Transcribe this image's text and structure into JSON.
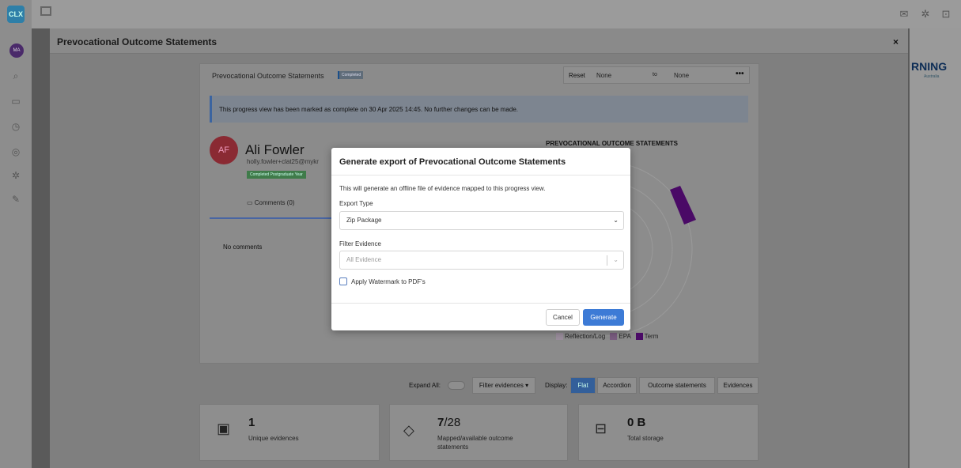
{
  "app": {
    "logo_text": "CLX",
    "user_initials": "MA",
    "brand_text": "RNING",
    "brand_sub": "Australia"
  },
  "outer_modal": {
    "title": "Prevocational Outcome Statements",
    "close_label": "×"
  },
  "progress_card": {
    "title": "Prevocational Outcome Statements",
    "status_badge": "Completed",
    "reset_label": "Reset",
    "from_value": "None",
    "to_label": "to",
    "to_value": "None",
    "more_label": "•••",
    "notice": "This progress view has been marked as complete on 30 Apr 2025 14:45. No further changes can be made.",
    "person": {
      "initials": "AF",
      "name": "Ali Fowler",
      "email": "holly.fowler+clat25@mykr",
      "badge": "Completed Postgraduate Year"
    },
    "comments_tab": "Comments (0)",
    "no_comments": "No comments",
    "chart_title": "PREVOCATIONAL OUTCOME STATEMENTS",
    "legend": [
      {
        "label": "Reflection/Log",
        "color": "#c9a8cf"
      },
      {
        "label": "EPA",
        "color": "#a45db0"
      },
      {
        "label": "Term",
        "color": "#6a0a92"
      }
    ]
  },
  "toolbar": {
    "expand_all": "Expand All:",
    "filter_evidences": "Filter evidences ▾",
    "display_label": "Display:",
    "display_options": [
      "Flat",
      "Accordion",
      "Outcome statements",
      "Evidences"
    ],
    "active_display": "Flat"
  },
  "stats": [
    {
      "value": "1",
      "label": "Unique evidences",
      "icon": "image-document-icon"
    },
    {
      "value": "7",
      "value_suffix": "/28",
      "label": "Mapped/available outcome statements",
      "icon": "tag-icon"
    },
    {
      "value": "0 B",
      "label": "Total storage",
      "icon": "hard-drive-icon"
    }
  ],
  "export_dialog": {
    "title": "Generate export of Prevocational Outcome Statements",
    "description": "This will generate an offline file of evidence mapped to this progress view.",
    "export_type_label": "Export Type",
    "export_type_value": "Zip Package",
    "filter_label": "Filter Evidence",
    "filter_placeholder": "All Evidence",
    "watermark_label": "Apply Watermark to PDF's",
    "watermark_checked": false,
    "cancel_label": "Cancel",
    "generate_label": "Generate",
    "generate_color": "#3d7bd6"
  }
}
